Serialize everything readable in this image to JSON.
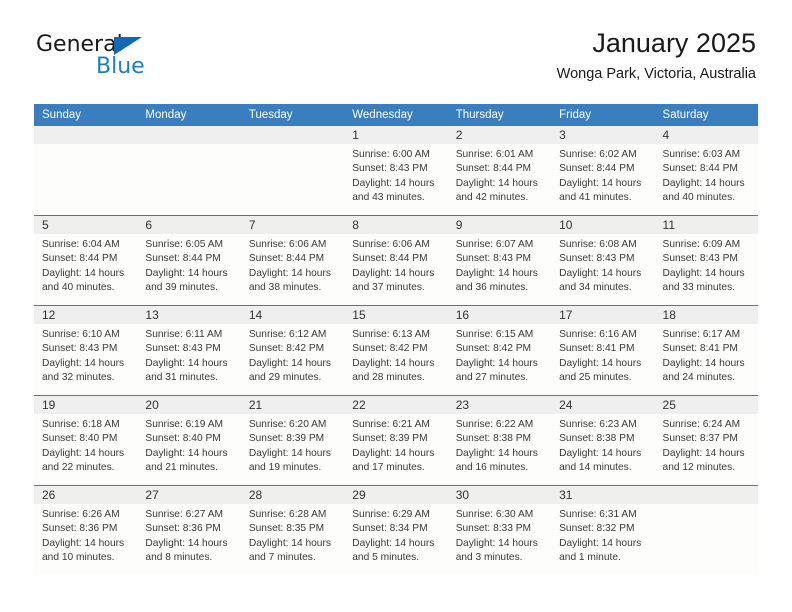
{
  "brand": {
    "name_part1": "General",
    "name_part2": "Blue",
    "accent_color": "#1f7fc4",
    "triangle_color": "#1268b3"
  },
  "header": {
    "title": "January 2025",
    "subtitle": "Wonga Park, Victoria, Australia"
  },
  "theme": {
    "header_bg": "#3a7ebf",
    "header_text": "#ffffff",
    "date_band_bg": "#efefef",
    "cell_bg": "#fdfdfc",
    "body_text": "#3a3a3a"
  },
  "calendar": {
    "day_headers": [
      "Sunday",
      "Monday",
      "Tuesday",
      "Wednesday",
      "Thursday",
      "Friday",
      "Saturday"
    ],
    "weeks": [
      [
        {
          "day": "",
          "empty": true,
          "lines": []
        },
        {
          "day": "",
          "empty": true,
          "lines": []
        },
        {
          "day": "",
          "empty": true,
          "lines": []
        },
        {
          "day": "1",
          "empty": false,
          "lines": [
            "Sunrise: 6:00 AM",
            "Sunset: 8:43 PM",
            "Daylight: 14 hours",
            "and 43 minutes."
          ]
        },
        {
          "day": "2",
          "empty": false,
          "lines": [
            "Sunrise: 6:01 AM",
            "Sunset: 8:44 PM",
            "Daylight: 14 hours",
            "and 42 minutes."
          ]
        },
        {
          "day": "3",
          "empty": false,
          "lines": [
            "Sunrise: 6:02 AM",
            "Sunset: 8:44 PM",
            "Daylight: 14 hours",
            "and 41 minutes."
          ]
        },
        {
          "day": "4",
          "empty": false,
          "lines": [
            "Sunrise: 6:03 AM",
            "Sunset: 8:44 PM",
            "Daylight: 14 hours",
            "and 40 minutes."
          ]
        }
      ],
      [
        {
          "day": "5",
          "empty": false,
          "lines": [
            "Sunrise: 6:04 AM",
            "Sunset: 8:44 PM",
            "Daylight: 14 hours",
            "and 40 minutes."
          ]
        },
        {
          "day": "6",
          "empty": false,
          "lines": [
            "Sunrise: 6:05 AM",
            "Sunset: 8:44 PM",
            "Daylight: 14 hours",
            "and 39 minutes."
          ]
        },
        {
          "day": "7",
          "empty": false,
          "lines": [
            "Sunrise: 6:06 AM",
            "Sunset: 8:44 PM",
            "Daylight: 14 hours",
            "and 38 minutes."
          ]
        },
        {
          "day": "8",
          "empty": false,
          "lines": [
            "Sunrise: 6:06 AM",
            "Sunset: 8:44 PM",
            "Daylight: 14 hours",
            "and 37 minutes."
          ]
        },
        {
          "day": "9",
          "empty": false,
          "lines": [
            "Sunrise: 6:07 AM",
            "Sunset: 8:43 PM",
            "Daylight: 14 hours",
            "and 36 minutes."
          ]
        },
        {
          "day": "10",
          "empty": false,
          "lines": [
            "Sunrise: 6:08 AM",
            "Sunset: 8:43 PM",
            "Daylight: 14 hours",
            "and 34 minutes."
          ]
        },
        {
          "day": "11",
          "empty": false,
          "lines": [
            "Sunrise: 6:09 AM",
            "Sunset: 8:43 PM",
            "Daylight: 14 hours",
            "and 33 minutes."
          ]
        }
      ],
      [
        {
          "day": "12",
          "empty": false,
          "lines": [
            "Sunrise: 6:10 AM",
            "Sunset: 8:43 PM",
            "Daylight: 14 hours",
            "and 32 minutes."
          ]
        },
        {
          "day": "13",
          "empty": false,
          "lines": [
            "Sunrise: 6:11 AM",
            "Sunset: 8:43 PM",
            "Daylight: 14 hours",
            "and 31 minutes."
          ]
        },
        {
          "day": "14",
          "empty": false,
          "lines": [
            "Sunrise: 6:12 AM",
            "Sunset: 8:42 PM",
            "Daylight: 14 hours",
            "and 29 minutes."
          ]
        },
        {
          "day": "15",
          "empty": false,
          "lines": [
            "Sunrise: 6:13 AM",
            "Sunset: 8:42 PM",
            "Daylight: 14 hours",
            "and 28 minutes."
          ]
        },
        {
          "day": "16",
          "empty": false,
          "lines": [
            "Sunrise: 6:15 AM",
            "Sunset: 8:42 PM",
            "Daylight: 14 hours",
            "and 27 minutes."
          ]
        },
        {
          "day": "17",
          "empty": false,
          "lines": [
            "Sunrise: 6:16 AM",
            "Sunset: 8:41 PM",
            "Daylight: 14 hours",
            "and 25 minutes."
          ]
        },
        {
          "day": "18",
          "empty": false,
          "lines": [
            "Sunrise: 6:17 AM",
            "Sunset: 8:41 PM",
            "Daylight: 14 hours",
            "and 24 minutes."
          ]
        }
      ],
      [
        {
          "day": "19",
          "empty": false,
          "lines": [
            "Sunrise: 6:18 AM",
            "Sunset: 8:40 PM",
            "Daylight: 14 hours",
            "and 22 minutes."
          ]
        },
        {
          "day": "20",
          "empty": false,
          "lines": [
            "Sunrise: 6:19 AM",
            "Sunset: 8:40 PM",
            "Daylight: 14 hours",
            "and 21 minutes."
          ]
        },
        {
          "day": "21",
          "empty": false,
          "lines": [
            "Sunrise: 6:20 AM",
            "Sunset: 8:39 PM",
            "Daylight: 14 hours",
            "and 19 minutes."
          ]
        },
        {
          "day": "22",
          "empty": false,
          "lines": [
            "Sunrise: 6:21 AM",
            "Sunset: 8:39 PM",
            "Daylight: 14 hours",
            "and 17 minutes."
          ]
        },
        {
          "day": "23",
          "empty": false,
          "lines": [
            "Sunrise: 6:22 AM",
            "Sunset: 8:38 PM",
            "Daylight: 14 hours",
            "and 16 minutes."
          ]
        },
        {
          "day": "24",
          "empty": false,
          "lines": [
            "Sunrise: 6:23 AM",
            "Sunset: 8:38 PM",
            "Daylight: 14 hours",
            "and 14 minutes."
          ]
        },
        {
          "day": "25",
          "empty": false,
          "lines": [
            "Sunrise: 6:24 AM",
            "Sunset: 8:37 PM",
            "Daylight: 14 hours",
            "and 12 minutes."
          ]
        }
      ],
      [
        {
          "day": "26",
          "empty": false,
          "lines": [
            "Sunrise: 6:26 AM",
            "Sunset: 8:36 PM",
            "Daylight: 14 hours",
            "and 10 minutes."
          ]
        },
        {
          "day": "27",
          "empty": false,
          "lines": [
            "Sunrise: 6:27 AM",
            "Sunset: 8:36 PM",
            "Daylight: 14 hours",
            "and 8 minutes."
          ]
        },
        {
          "day": "28",
          "empty": false,
          "lines": [
            "Sunrise: 6:28 AM",
            "Sunset: 8:35 PM",
            "Daylight: 14 hours",
            "and 7 minutes."
          ]
        },
        {
          "day": "29",
          "empty": false,
          "lines": [
            "Sunrise: 6:29 AM",
            "Sunset: 8:34 PM",
            "Daylight: 14 hours",
            "and 5 minutes."
          ]
        },
        {
          "day": "30",
          "empty": false,
          "lines": [
            "Sunrise: 6:30 AM",
            "Sunset: 8:33 PM",
            "Daylight: 14 hours",
            "and 3 minutes."
          ]
        },
        {
          "day": "31",
          "empty": false,
          "lines": [
            "Sunrise: 6:31 AM",
            "Sunset: 8:32 PM",
            "Daylight: 14 hours",
            "and 1 minute."
          ]
        },
        {
          "day": "",
          "empty": true,
          "lines": []
        }
      ]
    ]
  }
}
